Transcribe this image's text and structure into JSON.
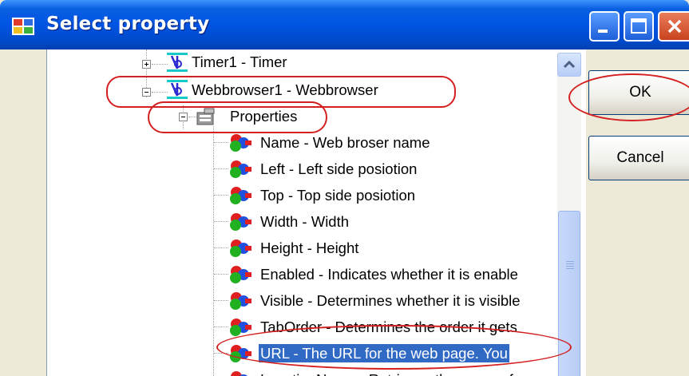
{
  "window": {
    "title": "Select property"
  },
  "tree": {
    "nodes": [
      {
        "label": "Timer1 - Timer",
        "expanded": false
      },
      {
        "label": "Webbrowser1 - Webbrowser",
        "expanded": true
      },
      {
        "label": "Properties",
        "expanded": true
      }
    ],
    "properties": [
      "Name - Web broser name",
      "Left - Left side posiotion",
      "Top - Top side posiotion",
      "Width - Width",
      "Height - Height",
      "Enabled - Indicates whether it is enable",
      "Visible - Determines whether it is visible",
      "TabOrder - Determines the order it gets",
      "URL - The URL for the web page. You",
      "LocationName - Retrieves the name of"
    ],
    "selected_property": "URL - The URL for the web page. You"
  },
  "buttons": {
    "ok": "OK",
    "cancel": "Cancel"
  },
  "annotation_color": "#d42020",
  "selection_color": "#316ac5"
}
